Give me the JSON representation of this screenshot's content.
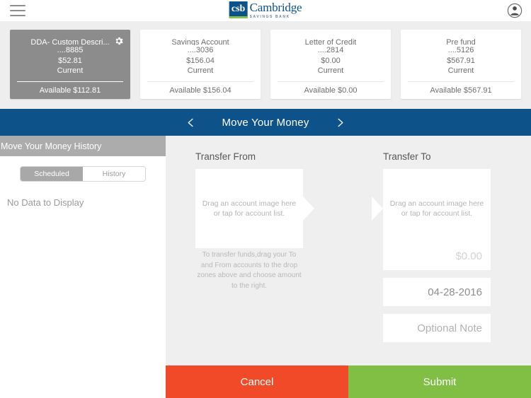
{
  "header": {
    "menu_icon": "hamburger-menu-icon",
    "brand_mark": "csb",
    "brand_name": "Cambridge",
    "brand_sub": "SAVINGS BANK",
    "user_icon": "user-account-icon"
  },
  "accounts": [
    {
      "name": "DDA- Custom Descri...",
      "number": "....8885",
      "balance": "$52.81",
      "type": "Current",
      "available": "Available $112.81",
      "selected": true,
      "has_gear": true
    },
    {
      "name": "Savings Account",
      "number": "....3036",
      "balance": "$156.04",
      "type": "Current",
      "available": "Available $156.04",
      "selected": false,
      "has_gear": false
    },
    {
      "name": "Letter of Credit",
      "number": "....2814",
      "balance": "$0.00",
      "type": "Current",
      "available": "Available $0.00",
      "selected": false,
      "has_gear": false
    },
    {
      "name": "Pre fund",
      "number": "....5126",
      "balance": "$567.91",
      "type": "Current",
      "available": "Available $567.91",
      "selected": false,
      "has_gear": false
    }
  ],
  "nav": {
    "prev_icon": "chevron-left-icon",
    "title": "Move Your Money",
    "next_icon": "chevron-right-icon"
  },
  "sidebar": {
    "header": "Move Your Money History",
    "tabs": [
      {
        "label": "Scheduled",
        "active": true
      },
      {
        "label": "History",
        "active": false
      }
    ],
    "empty_message": "No Data to Display"
  },
  "transfer": {
    "from_label": "Transfer From",
    "to_label": "Transfer To",
    "dropzone_text": "Drag an account image here or tap for account list.",
    "help_text": "To transfer funds,drag your To and From accounts to the drop zones above and choose amount to the right.",
    "amount_placeholder": "$0.00",
    "date_value": "04-28-2016",
    "note_placeholder": "Optional Note"
  },
  "footer": {
    "cancel_label": "Cancel",
    "submit_label": "Submit"
  },
  "colors": {
    "brand_blue": "#0d5289",
    "brand_green": "#8cc04a",
    "selected_card_gray": "#8c8c8c",
    "sidebar_header_gray": "#acacac",
    "cancel_red": "#f14a28",
    "submit_green": "#80bf44",
    "panel_bg": "#efefef",
    "strip_bg": "#eeeeee"
  }
}
